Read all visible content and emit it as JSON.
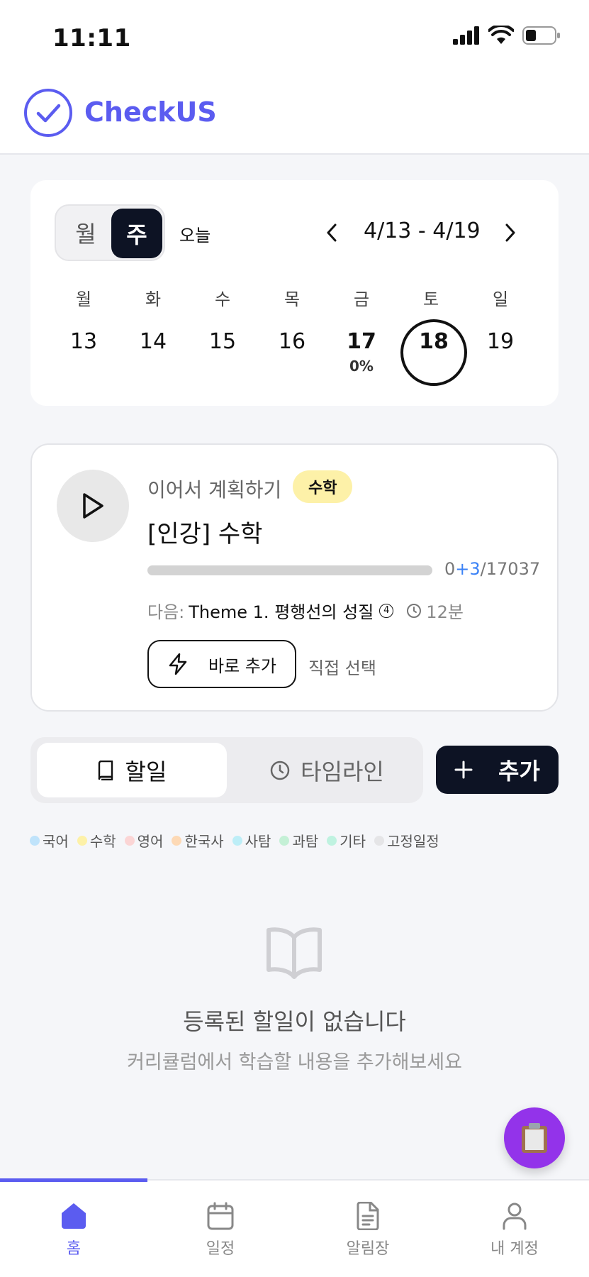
{
  "status_bar": {
    "time": "11:11"
  },
  "app": {
    "name": "CheckUS",
    "accent": "#5b5cf0"
  },
  "calendar": {
    "view_month": "월",
    "view_week": "주",
    "today": "오늘",
    "range": "4/13 - 4/19",
    "days": [
      {
        "dow": "월",
        "date": "13"
      },
      {
        "dow": "화",
        "date": "14"
      },
      {
        "dow": "수",
        "date": "15"
      },
      {
        "dow": "목",
        "date": "16"
      },
      {
        "dow": "금",
        "date": "17",
        "progress": "0%"
      },
      {
        "dow": "토",
        "date": "18"
      },
      {
        "dow": "일",
        "date": "19"
      }
    ]
  },
  "continue_card": {
    "label": "이어서 계획하기",
    "subject": "수학",
    "title": "[인강] 수학",
    "progress": {
      "done": "0",
      "added": "+3",
      "total": "/17037",
      "fraction": 0.0
    },
    "next_label": "다음:",
    "next_value": "Theme 1. 평행선의 성질",
    "next_badge": "4",
    "duration": "12분",
    "quick_add": "바로 추가",
    "manual_select": "직접 선택"
  },
  "tabs": {
    "todo": "할일",
    "timeline": "타임라인",
    "add": "추가"
  },
  "legend": [
    {
      "label": "국어",
      "color": "#bfe3fb"
    },
    {
      "label": "수학",
      "color": "#fdf1a8"
    },
    {
      "label": "영어",
      "color": "#fbd5d5"
    },
    {
      "label": "한국사",
      "color": "#fdd9b5"
    },
    {
      "label": "사탐",
      "color": "#bdeef7"
    },
    {
      "label": "과탐",
      "color": "#c4f0d6"
    },
    {
      "label": "기타",
      "color": "#bff2e0"
    },
    {
      "label": "고정일정",
      "color": "#e5e5e7"
    }
  ],
  "empty": {
    "title": "등록된 할일이 없습니다",
    "subtitle": "커리큘럼에서 학습할 내용을 추가해보세요"
  },
  "bottom_nav": [
    {
      "label": "홈",
      "icon": "home-icon"
    },
    {
      "label": "일정",
      "icon": "calendar-icon"
    },
    {
      "label": "알림장",
      "icon": "document-icon"
    },
    {
      "label": "내 계정",
      "icon": "user-icon"
    }
  ]
}
